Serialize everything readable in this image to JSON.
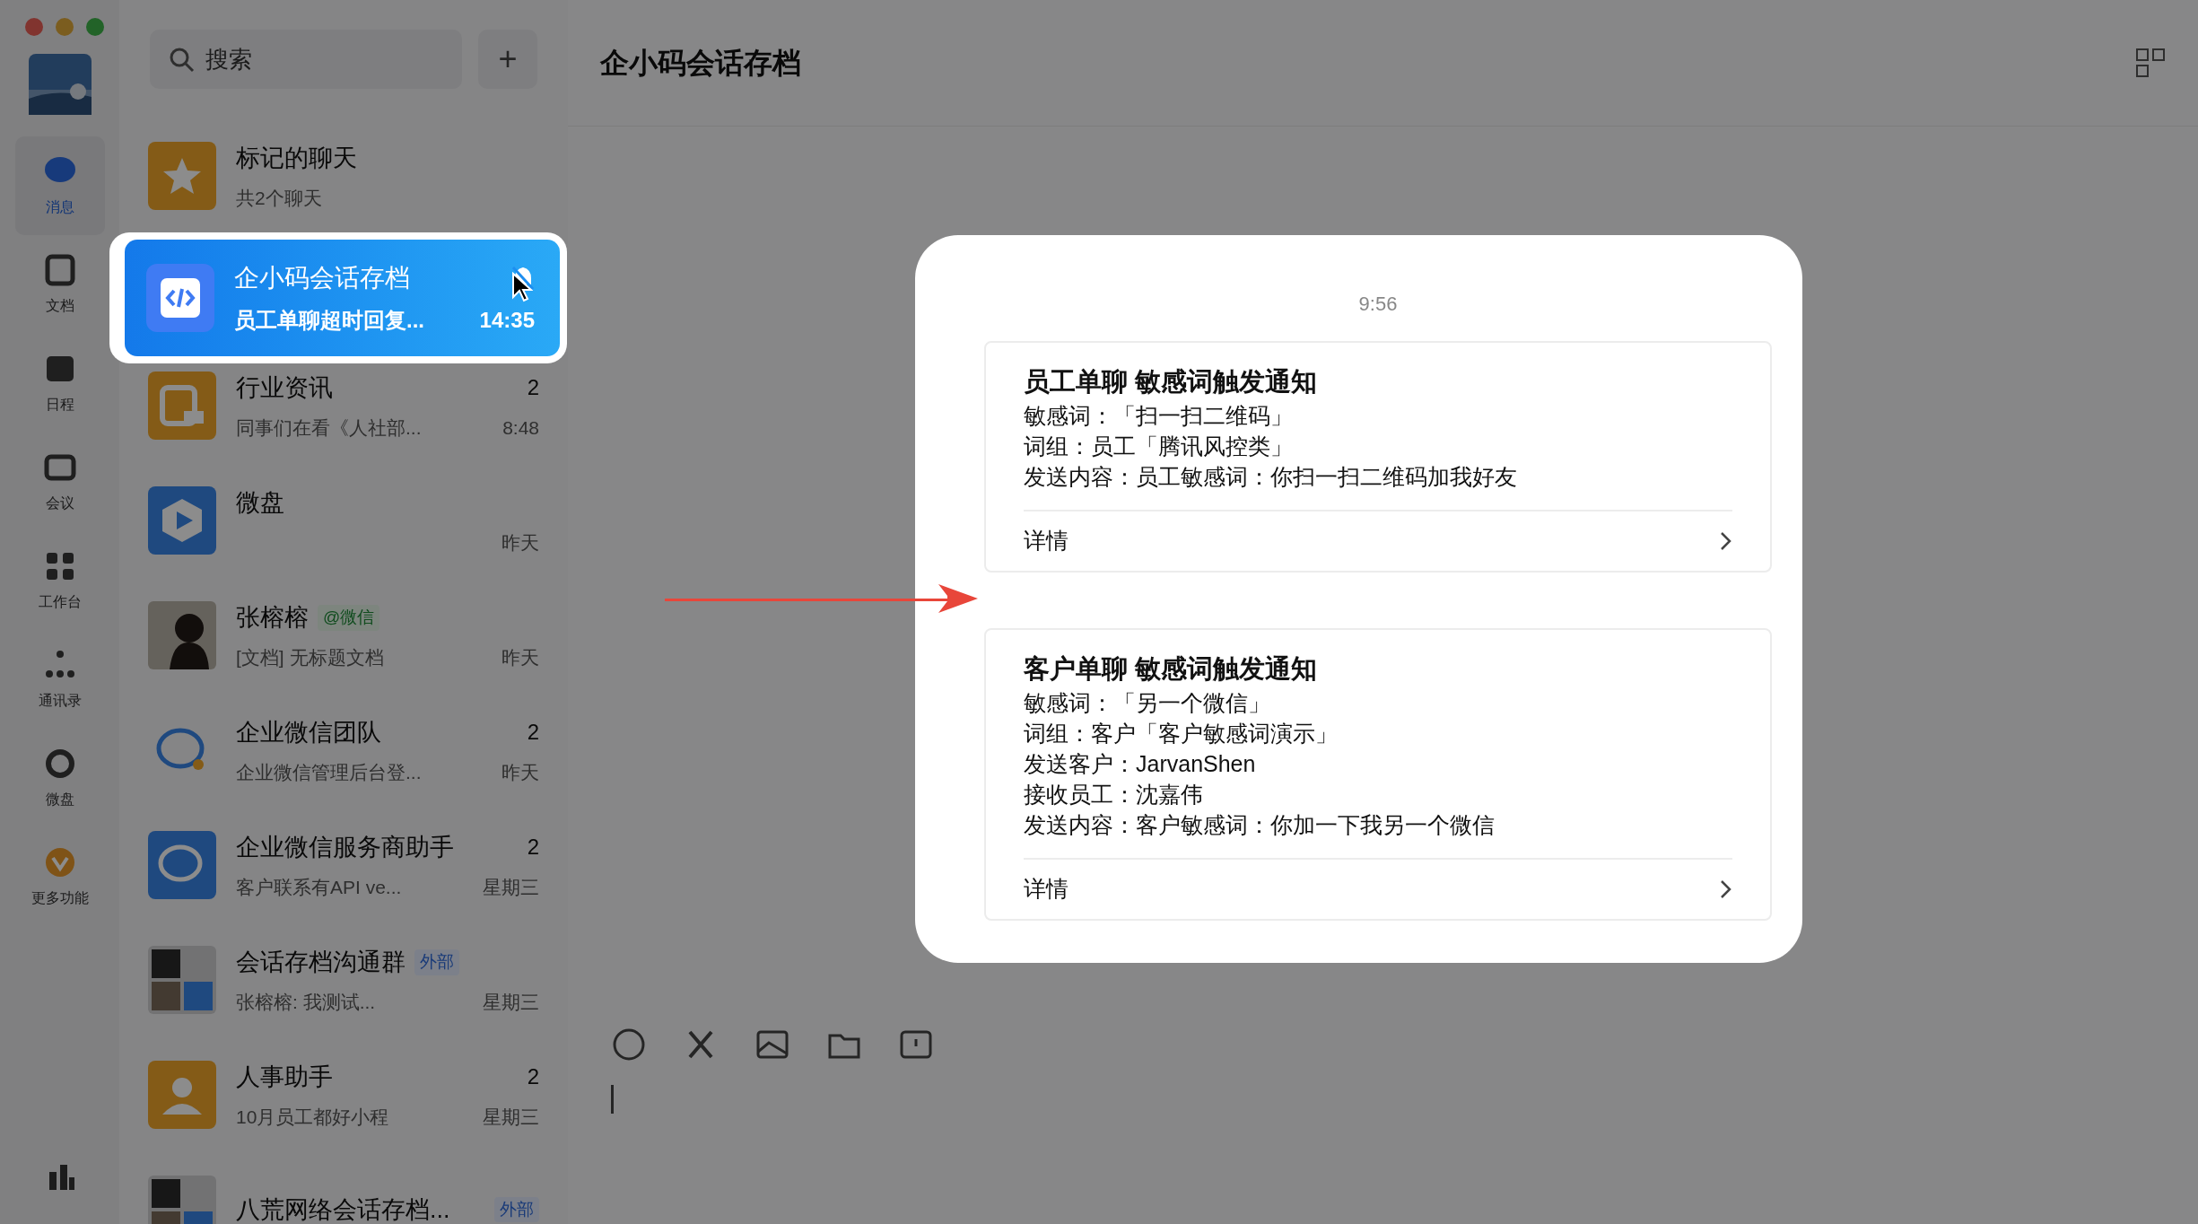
{
  "sidebar": {
    "items": [
      {
        "kind": "message",
        "label": "消息",
        "selected": true
      },
      {
        "kind": "doc",
        "label": "文档",
        "selected": false
      },
      {
        "kind": "calendar",
        "label": "日程",
        "selected": false
      },
      {
        "kind": "meeting",
        "label": "会议",
        "selected": false
      },
      {
        "kind": "apps",
        "label": "工作台",
        "selected": false
      },
      {
        "kind": "contacts",
        "label": "通讯录",
        "selected": false
      },
      {
        "kind": "drive",
        "label": "微盘",
        "selected": false
      },
      {
        "kind": "more",
        "label": "更多功能",
        "selected": false
      }
    ]
  },
  "search": {
    "placeholder": "搜索",
    "add_button": "+"
  },
  "chats": [
    {
      "kind": "star",
      "title": "标记的聊天",
      "preview": "共2个聊天",
      "highlighted": false
    },
    {
      "kind": "code",
      "title": "企小码会话存档",
      "preview": "员工单聊超时回复...",
      "time": "14:35",
      "muted": true,
      "highlighted": true
    },
    {
      "kind": "news",
      "title": "行业资讯",
      "preview": "同事们在看《人社部...",
      "time": "8:48",
      "badge": "2",
      "highlighted": false
    },
    {
      "kind": "drive",
      "title": "微盘",
      "time": "昨天",
      "highlighted": false
    },
    {
      "kind": "person",
      "title": "张榕榕",
      "tag": {
        "text": "@微信",
        "kind": "wechat"
      },
      "preview": "[文档] 无标题文档",
      "time": "昨天",
      "highlighted": false
    },
    {
      "kind": "wecom",
      "title": "企业微信团队",
      "preview": "企业微信管理后台登...",
      "time": "昨天",
      "badge": "2",
      "highlighted": false
    },
    {
      "kind": "service",
      "title": "企业微信服务商助手",
      "preview": "客户联系有API ve...",
      "time": "星期三",
      "badge": "2",
      "highlighted": false
    },
    {
      "kind": "group",
      "title": "会话存档沟通群",
      "tag": {
        "text": "外部",
        "kind": "external"
      },
      "preview": "张榕榕: 我测试...",
      "time": "星期三",
      "highlighted": false
    },
    {
      "kind": "hr",
      "title": "人事助手",
      "preview": "10月员工都好小程",
      "time": "星期三",
      "badge": "2",
      "highlighted": false
    },
    {
      "kind": "group",
      "title": "八荒网络会话存档...",
      "tag": {
        "text": "外部",
        "kind": "external"
      },
      "highlighted": false
    }
  ],
  "chat_header": {
    "title": "企小码会话存档"
  },
  "message_popup": {
    "time": "9:56",
    "cards": [
      {
        "title": "员工单聊 敏感词触发通知",
        "lines": [
          "敏感词：「扫一扫二维码」",
          "词组：员工「腾讯风控类」",
          "发送内容：员工敏感词：你扫一扫二维码加我好友"
        ],
        "link": "详情"
      },
      {
        "title": "客户单聊 敏感词触发通知",
        "lines": [
          "敏感词：「另一个微信」",
          "词组：客户「客户敏感词演示」",
          "发送客户：JarvanShen",
          "接收员工：沈嘉伟",
          "发送内容：客户敏感词：你加一下我另一个微信"
        ],
        "link": "详情"
      }
    ]
  }
}
